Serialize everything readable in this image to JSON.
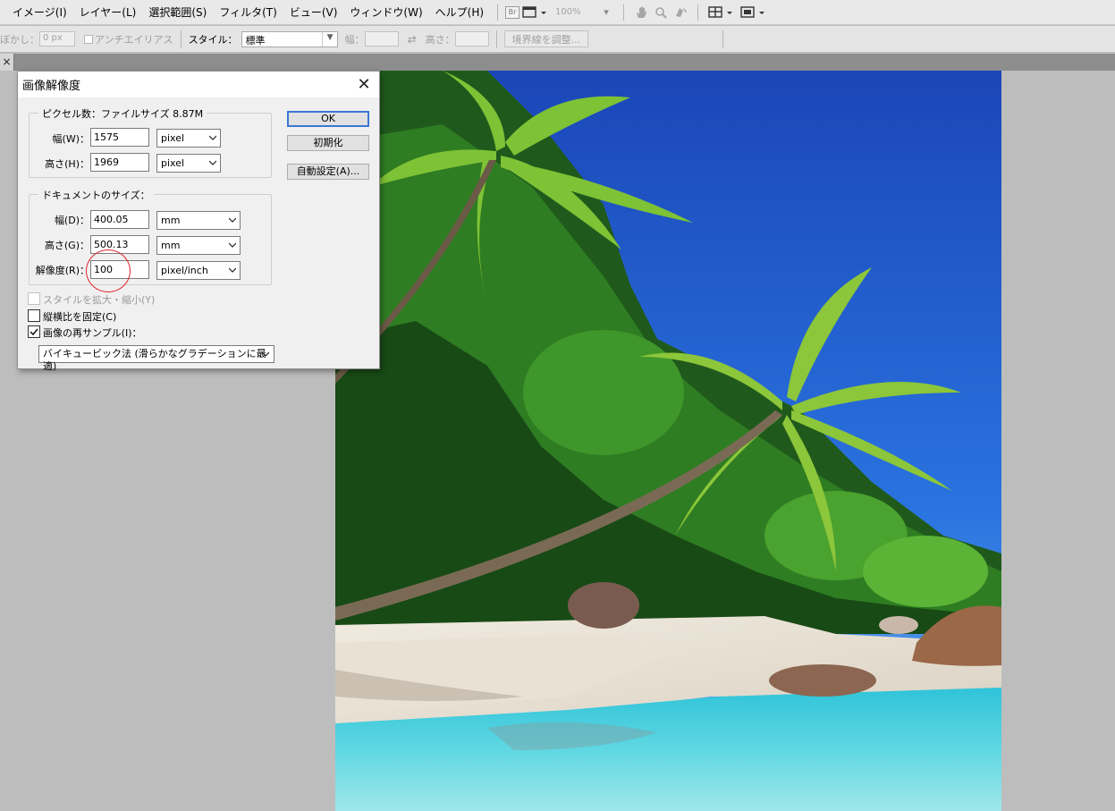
{
  "menubar": {
    "items": [
      "イメージ(I)",
      "レイヤー(L)",
      "選択範囲(S)",
      "フィルタ(T)",
      "ビュー(V)",
      "ウィンドウ(W)",
      "ヘルプ(H)"
    ],
    "br_label": "Br",
    "zoom": "100%"
  },
  "options": {
    "feather_label": "ぼかし：",
    "feather_value": "0 px",
    "antialias_label": "アンチエイリアス",
    "style_label": "スタイル：",
    "style_value": "標準",
    "width_label": "幅：",
    "height_label": "高さ：",
    "refine_edge_button": "境界線を調整..."
  },
  "tab": {
    "close_glyph": "×"
  },
  "dialog": {
    "title": "画像解像度",
    "pixel_group_legend": "ピクセル数：ファイルサイズ 8.87M",
    "pixel_width_label": "幅(W)：",
    "pixel_width_value": "1575",
    "pixel_width_unit": "pixel",
    "pixel_height_label": "高さ(H)：",
    "pixel_height_value": "1969",
    "pixel_height_unit": "pixel",
    "doc_group_legend": "ドキュメントのサイズ：",
    "doc_width_label": "幅(D)：",
    "doc_width_value": "400.05",
    "doc_width_unit": "mm",
    "doc_height_label": "高さ(G)：",
    "doc_height_value": "500.13",
    "doc_height_unit": "mm",
    "resolution_label": "解像度(R)：",
    "resolution_value": "100",
    "resolution_unit": "pixel/inch",
    "ok_button": "OK",
    "reset_button": "初期化",
    "auto_button": "自動設定(A)...",
    "scale_styles_label": "スタイルを拡大・縮小(Y)",
    "constrain_label": "縦横比を固定(C)",
    "resample_label": "画像の再サンプル(I)：",
    "resample_method": "バイキュービック法 (滑らかなグラデーションに最適)",
    "scale_styles_checked": false,
    "constrain_checked": false,
    "resample_checked": true
  },
  "colors": {
    "highlight_ring": "#e0242a",
    "ok_button_border": "#3a77d6",
    "sky": "#1a56c8",
    "water": "#33c9d8",
    "sand": "#efe8dc"
  }
}
